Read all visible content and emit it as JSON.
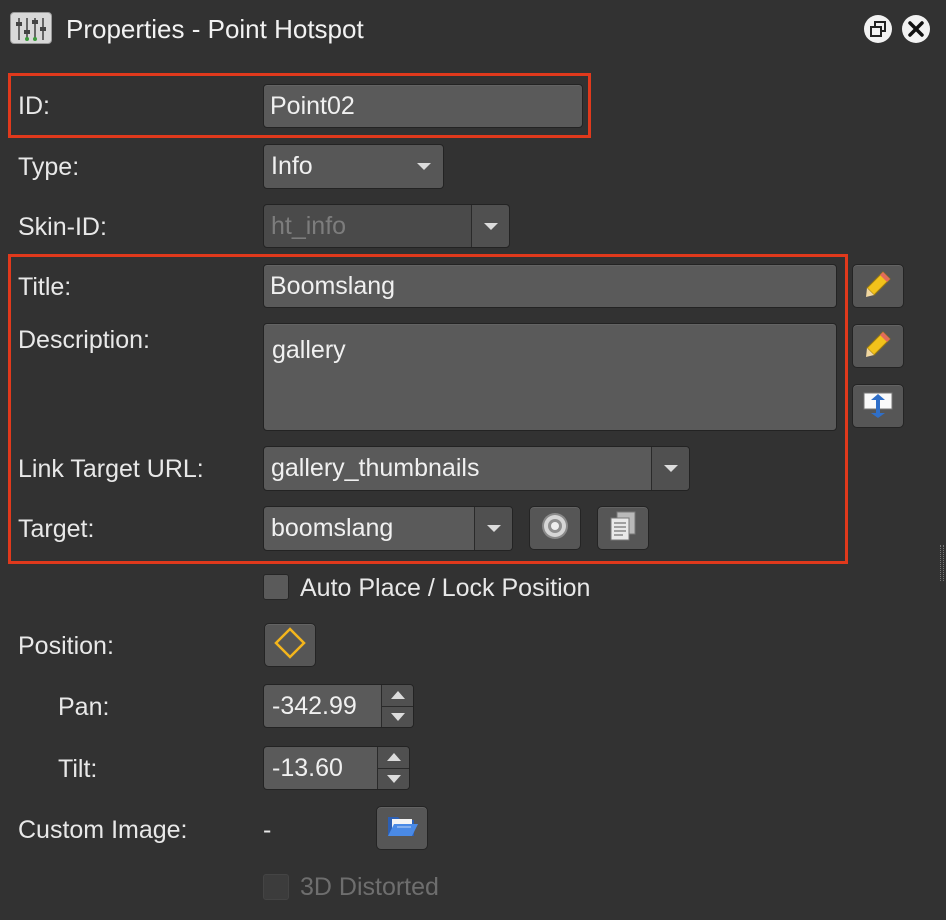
{
  "window": {
    "title": "Properties - Point Hotspot",
    "app_icon": "sliders-icon",
    "float_icon": "window-restore-icon",
    "close_icon": "close-circle-icon"
  },
  "colors": {
    "highlight": "#e0391c",
    "background": "#323232"
  },
  "form": {
    "id": {
      "label": "ID:",
      "value": "Point02"
    },
    "type": {
      "label": "Type:",
      "value": "Info"
    },
    "skin_id": {
      "label": "Skin-ID:",
      "value": "ht_info"
    },
    "title": {
      "label": "Title:",
      "value": "Boomslang"
    },
    "description": {
      "label": "Description:",
      "value": "gallery"
    },
    "link_url": {
      "label": "Link Target URL:",
      "value": "gallery_thumbnails"
    },
    "target": {
      "label": "Target:",
      "value": "boomslang"
    },
    "auto_place": {
      "label": "Auto Place / Lock Position",
      "checked": false
    },
    "position": {
      "label": "Position:"
    },
    "pan": {
      "label": "Pan:",
      "value": "-342.99"
    },
    "tilt": {
      "label": "Tilt:",
      "value": "-13.60"
    },
    "custom_image": {
      "label": "Custom Image:",
      "value": "-"
    },
    "distorted": {
      "label": "3D Distorted",
      "checked": false
    }
  }
}
